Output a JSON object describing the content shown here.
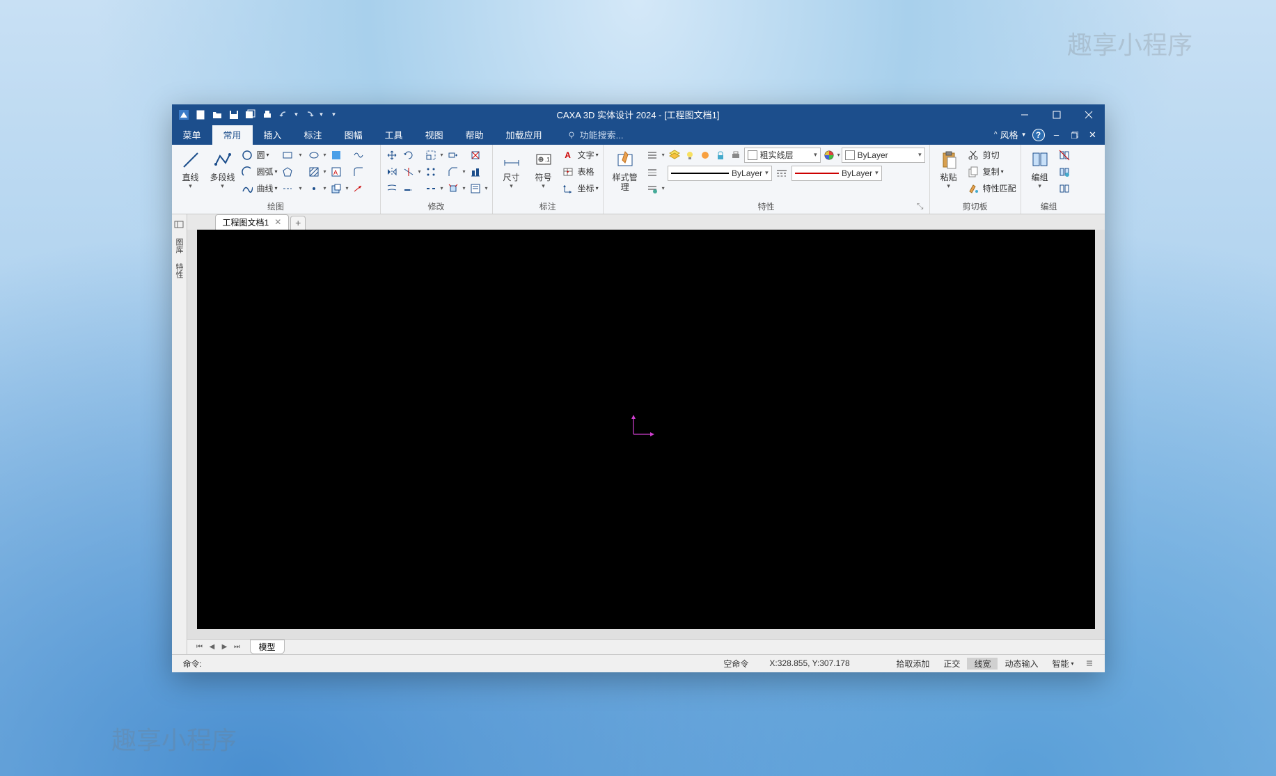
{
  "title": "CAXA 3D 实体设计 2024 - [工程图文档1]",
  "watermark": "趣享小程序",
  "ribbon": {
    "menu": "菜单",
    "tabs": [
      "常用",
      "插入",
      "标注",
      "图幅",
      "工具",
      "视图",
      "帮助",
      "加载应用"
    ],
    "active": "常用",
    "search_placeholder": "功能搜索...",
    "style": "风格"
  },
  "groups": {
    "draw": {
      "label": "绘图",
      "line": "直线",
      "polyline": "多段线",
      "circle": "圆",
      "arc": "圆弧",
      "curve": "曲线"
    },
    "modify": {
      "label": "修改"
    },
    "annotate": {
      "label": "标注",
      "dim": "尺寸",
      "symbol": "符号",
      "text": "文字",
      "table": "表格",
      "coord": "坐标"
    },
    "props": {
      "label": "特性",
      "style_mgr": "样式管理",
      "layer": "粗实线层",
      "bylayer": "ByLayer"
    },
    "clipboard": {
      "label": "剪切板",
      "paste": "粘贴",
      "cut": "剪切",
      "copy": "复制",
      "match": "特性匹配"
    },
    "group": {
      "label": "编组",
      "group_btn": "编组"
    }
  },
  "side_panels": [
    "图库",
    "特性"
  ],
  "doc_tab": "工程图文档1",
  "sheet_tab": "模型",
  "status": {
    "command_label": "命令:",
    "empty_cmd": "空命令",
    "coords": "X:328.855, Y:307.178",
    "pick_add": "拾取添加",
    "ortho": "正交",
    "lineweight": "线宽",
    "dyn_input": "动态输入",
    "smart": "智能"
  }
}
